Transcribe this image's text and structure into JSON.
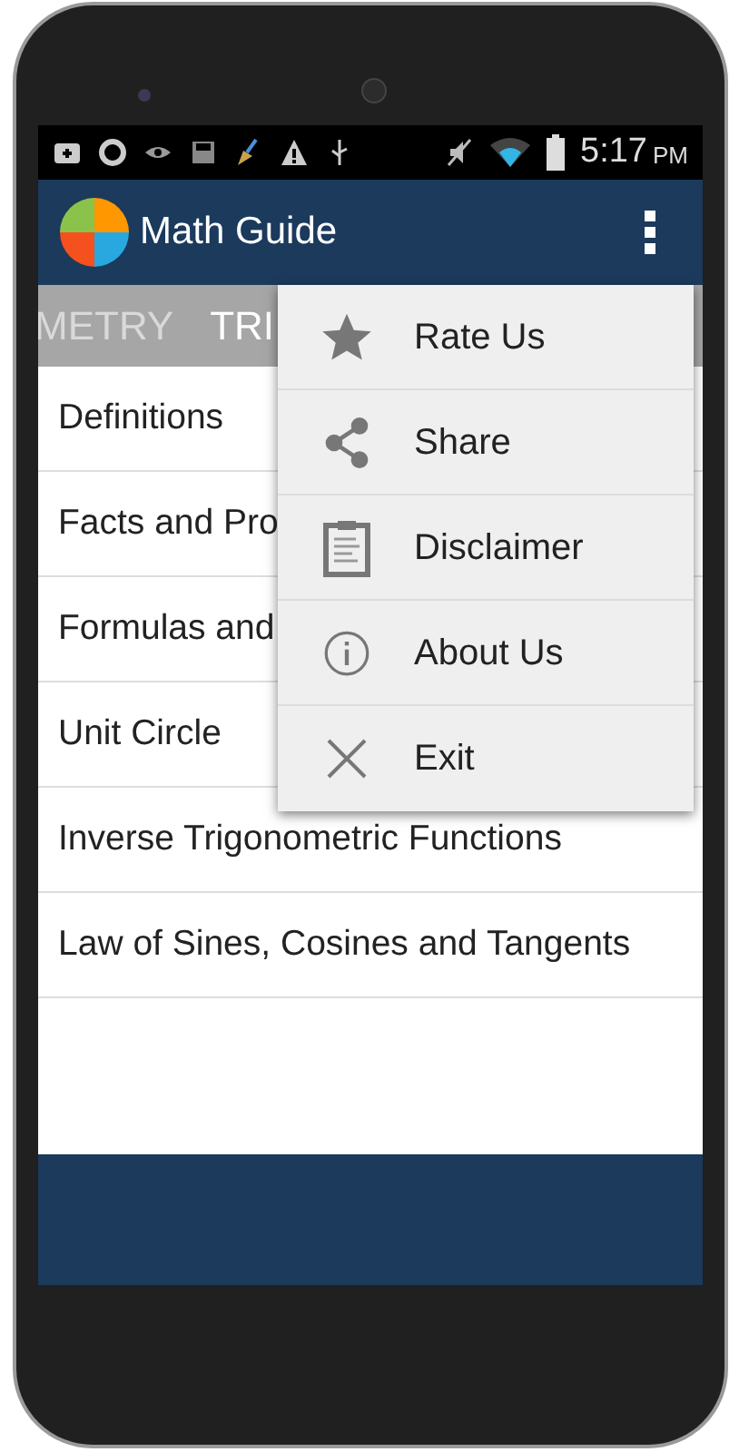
{
  "status_bar": {
    "time": "5:17",
    "meridiem": "PM"
  },
  "app_bar": {
    "title": "Math Guide"
  },
  "tabs": [
    {
      "label": "METRY",
      "selected": false
    },
    {
      "label": "TRI",
      "selected": true
    }
  ],
  "list": [
    "Definitions",
    "Facts and Pro",
    "Formulas and",
    "Unit Circle",
    "Inverse Trigonometric Functions",
    "Law of Sines, Cosines and Tangents"
  ],
  "menu": [
    {
      "kind": "star",
      "label": "Rate Us"
    },
    {
      "kind": "share",
      "label": "Share"
    },
    {
      "kind": "clipboard",
      "label": "Disclaimer"
    },
    {
      "kind": "info",
      "label": "About Us"
    },
    {
      "kind": "close",
      "label": "Exit"
    }
  ]
}
